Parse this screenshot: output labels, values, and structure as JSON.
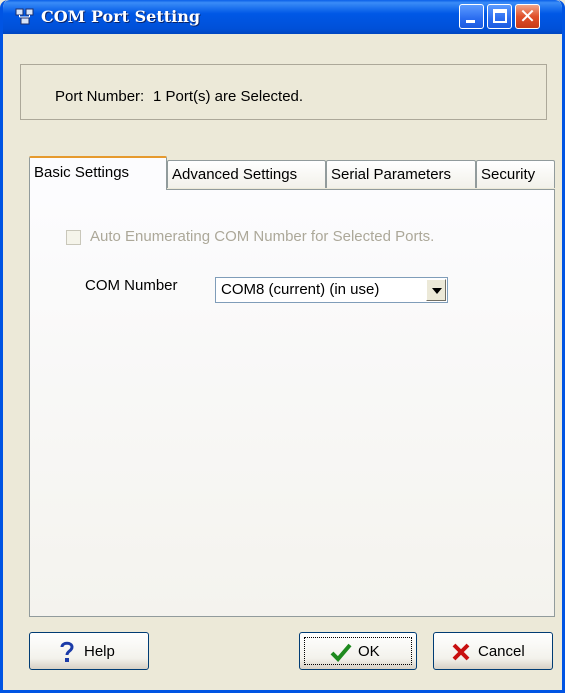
{
  "window": {
    "title": "COM Port Setting",
    "controls": {
      "minimize": "minimize-icon",
      "maximize": "maximize-icon",
      "close": "close-icon"
    }
  },
  "port": {
    "label": "Port Number:",
    "value": "1 Port(s) are Selected."
  },
  "tabs": [
    {
      "label": "Basic Settings",
      "active": true
    },
    {
      "label": "Advanced Settings",
      "active": false
    },
    {
      "label": "Serial Parameters",
      "active": false
    },
    {
      "label": "Security",
      "active": false
    }
  ],
  "basic": {
    "auto_enum_label": "Auto Enumerating COM Number for Selected Ports.",
    "auto_enum_checked": false,
    "auto_enum_enabled": false,
    "com_label": "COM Number",
    "com_value": "COM8 (current) (in use)"
  },
  "buttons": {
    "help": "Help",
    "ok": "OK",
    "cancel": "Cancel"
  },
  "colors": {
    "titlebar": "#0058E6",
    "face": "#ECE9D8",
    "active_tab_accent": "#E69A2E",
    "disabled_text": "#ACA899"
  }
}
